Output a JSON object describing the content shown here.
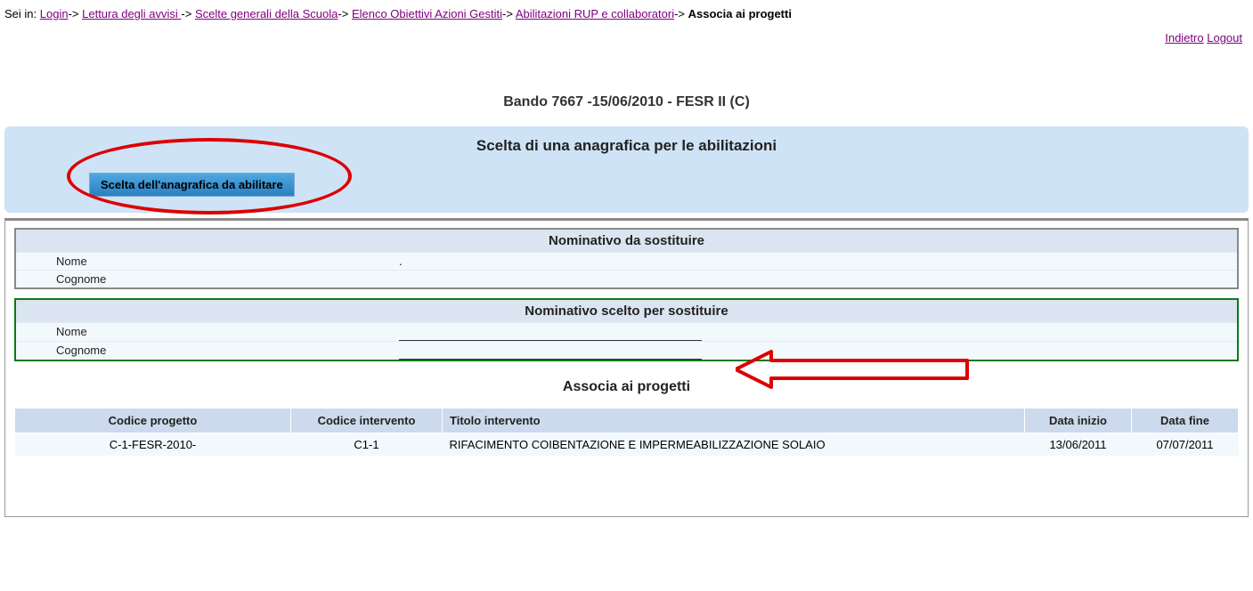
{
  "breadcrumb": {
    "prefix": "Sei in:",
    "items": [
      {
        "label": "Login"
      },
      {
        "label": "Lettura degli avvisi "
      },
      {
        "label": "Scelte generali della Scuola"
      },
      {
        "label": "Elenco Obiettivi Azioni Gestiti"
      },
      {
        "label": "Abilitazioni RUP e collaboratori"
      }
    ],
    "current": "Associa ai progetti"
  },
  "top_links": {
    "indietro": "Indietro",
    "logout": "Logout"
  },
  "bando_title": "Bando 7667 -15/06/2010 - FESR II (C)",
  "section": {
    "title": "Scelta di una anagrafica per le abilitazioni",
    "button": "Scelta dell'anagrafica da abilitare"
  },
  "panel_replace": {
    "header": "Nominativo da sostituire",
    "nome_label": "Nome",
    "nome_value": ".",
    "cognome_label": "Cognome",
    "cognome_value": ""
  },
  "panel_chosen": {
    "header": "Nominativo scelto per sostituire",
    "nome_label": "Nome",
    "nome_value": "",
    "cognome_label": "Cognome",
    "cognome_value": ""
  },
  "associa_title": "Associa ai progetti",
  "table": {
    "headers": {
      "codice_progetto": "Codice progetto",
      "codice_intervento": "Codice intervento",
      "titolo_intervento": "Titolo intervento",
      "data_inizio": "Data inizio",
      "data_fine": "Data fine"
    },
    "rows": [
      {
        "codice_progetto": "C-1-FESR-2010-",
        "codice_intervento": "C1-1",
        "titolo_intervento": "RIFACIMENTO COIBENTAZIONE E IMPERMEABILIZZAZIONE SOLAIO",
        "data_inizio": "13/06/2011",
        "data_fine": "07/07/2011"
      }
    ]
  }
}
